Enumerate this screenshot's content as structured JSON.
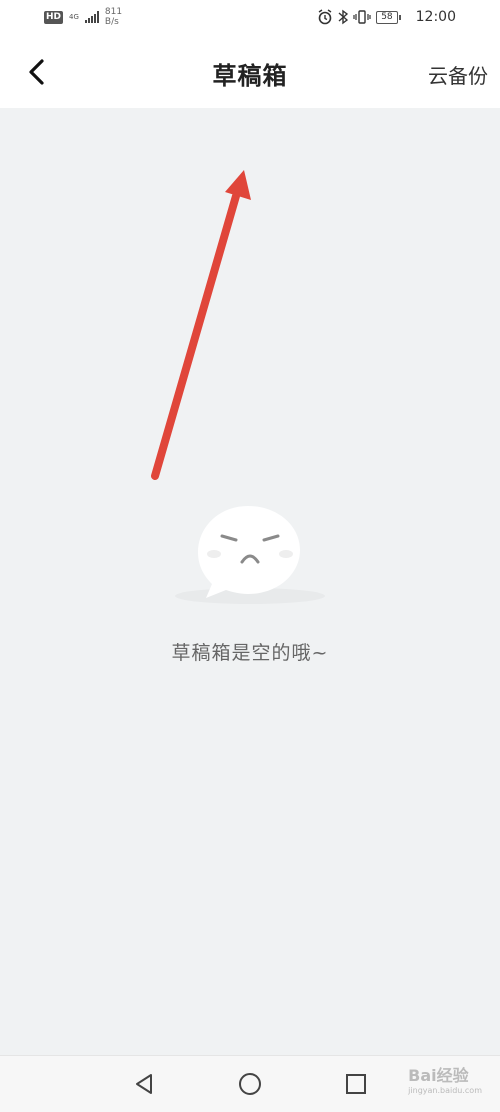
{
  "status_bar": {
    "hd": "HD",
    "network": "4G",
    "speed_value": "811",
    "speed_unit": "B/s",
    "battery": "58",
    "time": "12:00"
  },
  "header": {
    "title": "草稿箱",
    "action": "云备份"
  },
  "empty_state": {
    "message": "草稿箱是空的哦~"
  },
  "watermark": {
    "text": "Bai经验",
    "sub": "jingyan.baidu.com"
  },
  "colors": {
    "annotation_arrow": "#e0463a",
    "background": "#f0f2f3"
  },
  "icons": {
    "back": "chevron-left-icon",
    "empty": "sad-face-bubble-icon",
    "nav_back": "triangle-back-icon",
    "nav_home": "circle-home-icon",
    "nav_recent": "square-recent-icon"
  }
}
